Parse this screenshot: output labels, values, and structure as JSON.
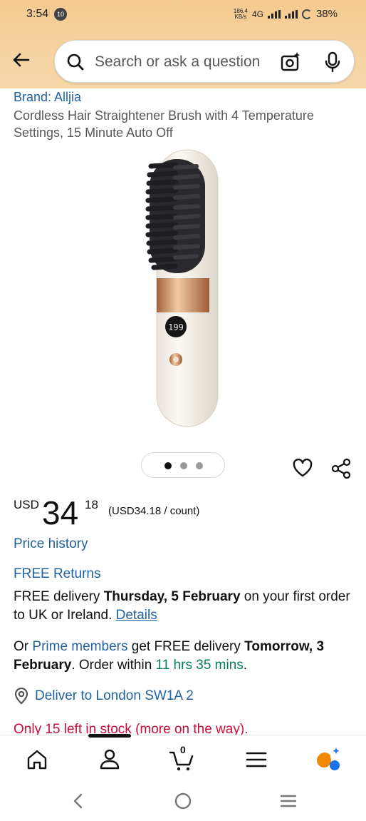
{
  "status_bar": {
    "time": "3:54",
    "notification_badge": "10",
    "speed_value": "186.4",
    "speed_unit": "KB/s",
    "network": "4G",
    "battery": "38%"
  },
  "header": {
    "search_placeholder": "Search or ask a question",
    "icons": [
      "back-arrow-icon",
      "search-icon",
      "camera-icon",
      "mic-icon"
    ]
  },
  "product": {
    "brand": "Brand: Alljia",
    "title": "Cordless Hair Straightener Brush with 4 Temperature Settings, 15 Minute Auto Off",
    "display_readout": "199",
    "image_count": 3,
    "active_image_index": 0
  },
  "price": {
    "currency": "USD",
    "whole": "34",
    "fraction": "18",
    "unit_price": "(USD34.18 / count)"
  },
  "links": {
    "price_history": "Price history",
    "free_returns": "FREE Returns"
  },
  "delivery": {
    "prefix": "FREE delivery ",
    "date": "Thursday, 5 February",
    "suffix": " on your first order to UK or Ireland. ",
    "details_link": "Details"
  },
  "prime": {
    "prefix": "Or ",
    "members_link": "Prime members",
    "middle": " get FREE delivery ",
    "date": "Tomorrow, 3 February",
    "order_within": ". Order within ",
    "countdown": "11 hrs 35 mins",
    "end": "."
  },
  "location": {
    "text": "Deliver to London SW1A 2"
  },
  "stock": {
    "text": "Only 15 left in stock (more on the way)."
  },
  "bottom_nav": {
    "items": [
      "home-icon",
      "account-icon",
      "cart-icon",
      "menu-icon",
      "rufus-ai-icon"
    ],
    "cart_count": "0"
  },
  "colors": {
    "header_gradient_top": "#f3c98e",
    "link": "#2162a1",
    "green": "#067d62",
    "stock_red": "#cc0c39",
    "brush_accent": "#c8916a"
  }
}
